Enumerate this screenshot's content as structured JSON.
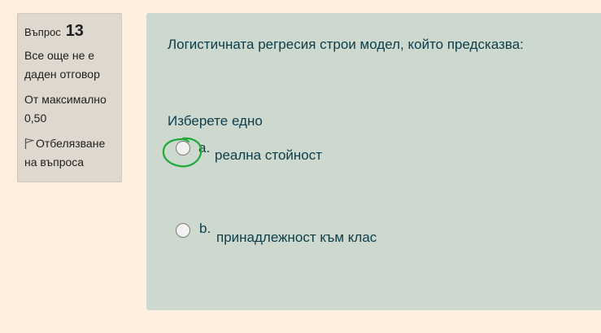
{
  "question_info": {
    "label": "Въпрос",
    "number": "13",
    "state": "Все още не е даден отговор",
    "grade": "От максимално 0,50",
    "flag_label": "Отбелязване на въпроса"
  },
  "question": {
    "text": "Логистичната регресия строи модел, който предсказва:",
    "prompt": "Изберете едно",
    "options": [
      {
        "letter": "a.",
        "text": "реална стойност",
        "selected": false
      },
      {
        "letter": "b.",
        "text": "принадлежност към клас",
        "selected": false
      }
    ]
  },
  "colors": {
    "page_background": "#fdf0e1",
    "info_panel": "#ded8ce",
    "content_panel": "#cdd8cf",
    "text": "#0d3d49",
    "annotation": "#1faa3a"
  }
}
